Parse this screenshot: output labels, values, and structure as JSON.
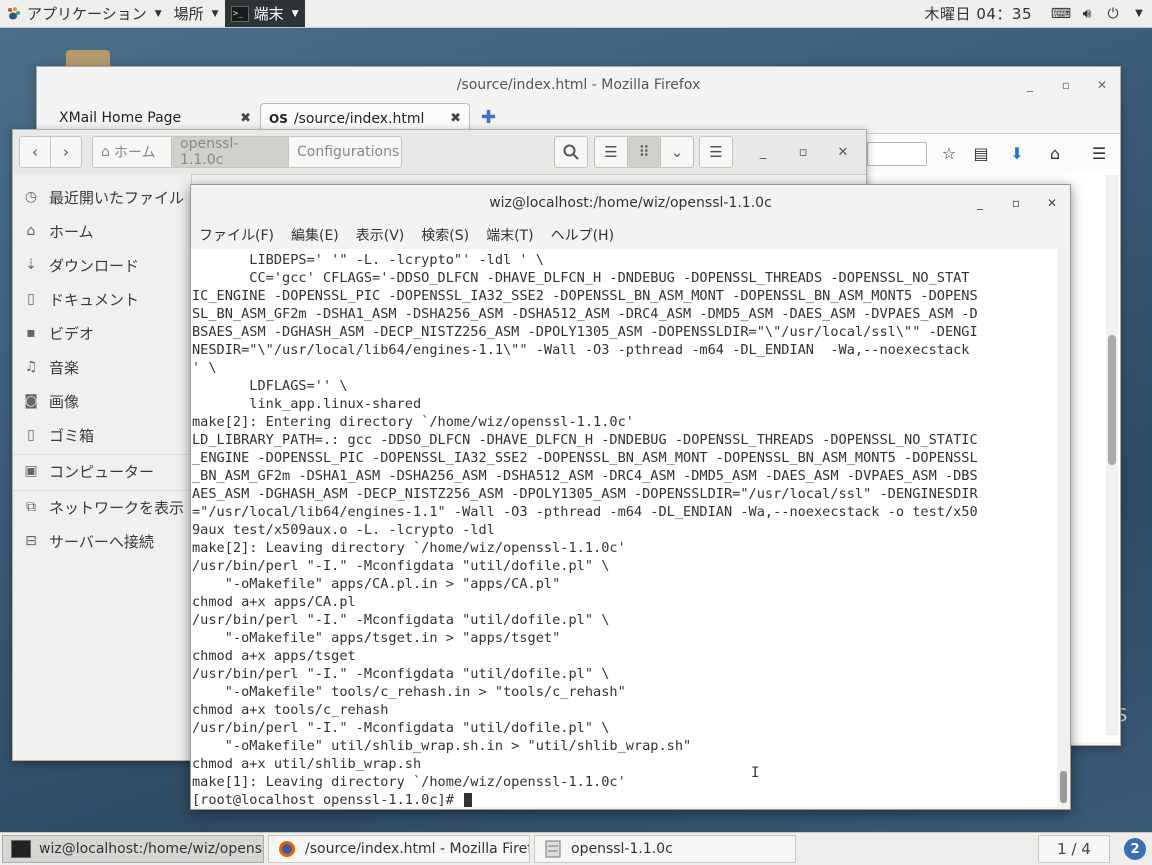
{
  "top_panel": {
    "applications": "アプリケーション",
    "places": "場所",
    "terminal": "端末",
    "clock": "木曜日 04：35"
  },
  "firefox": {
    "title": "/source/index.html - Mozilla Firefox",
    "tabs": [
      {
        "label": "XMail Home Page"
      },
      {
        "label": "/source/index.html"
      }
    ]
  },
  "files": {
    "path": [
      "ホーム",
      "openssl-1.1.0c",
      "Configurations"
    ],
    "sidebar": [
      {
        "label": "最近開いたファイル",
        "icon": "clock-icon"
      },
      {
        "label": "ホーム",
        "icon": "home-icon"
      },
      {
        "label": "ダウンロード",
        "icon": "download-icon"
      },
      {
        "label": "ドキュメント",
        "icon": "document-icon"
      },
      {
        "label": "ビデオ",
        "icon": "video-icon"
      },
      {
        "label": "音楽",
        "icon": "music-icon"
      },
      {
        "label": "画像",
        "icon": "camera-icon"
      },
      {
        "label": "ゴミ箱",
        "icon": "trash-icon"
      },
      {
        "label": "コンピューター",
        "icon": "computer-icon"
      },
      {
        "label": "ネットワークを表示",
        "icon": "network-icon"
      },
      {
        "label": "サーバーへ接続",
        "icon": "server-icon"
      }
    ]
  },
  "terminal": {
    "title": "wiz@localhost:/home/wiz/openssl-1.1.0c",
    "menu": [
      "ファイル(F)",
      "編集(E)",
      "表示(V)",
      "検索(S)",
      "端末(T)",
      "ヘルプ(H)"
    ],
    "lines": [
      "       LIBDEPS=' '\" -L. -lcrypto\"' -ldl ' \\",
      "       CC='gcc' CFLAGS='-DDSO_DLFCN -DHAVE_DLFCN_H -DNDEBUG -DOPENSSL_THREADS -DOPENSSL_NO_STAT",
      "IC_ENGINE -DOPENSSL_PIC -DOPENSSL_IA32_SSE2 -DOPENSSL_BN_ASM_MONT -DOPENSSL_BN_ASM_MONT5 -DOPENS",
      "SL_BN_ASM_GF2m -DSHA1_ASM -DSHA256_ASM -DSHA512_ASM -DRC4_ASM -DMD5_ASM -DAES_ASM -DVPAES_ASM -D",
      "BSAES_ASM -DGHASH_ASM -DECP_NISTZ256_ASM -DPOLY1305_ASM -DOPENSSLDIR=\"\\\"/usr/local/ssl\\\"\" -DENGI",
      "NESDIR=\"\\\"/usr/local/lib64/engines-1.1\\\"\" -Wall -O3 -pthread -m64 -DL_ENDIAN  -Wa,--noexecstack",
      "' \\",
      "       LDFLAGS='' \\",
      "       link_app.linux-shared",
      "make[2]: Entering directory `/home/wiz/openssl-1.1.0c'",
      "LD_LIBRARY_PATH=.: gcc -DDSO_DLFCN -DHAVE_DLFCN_H -DNDEBUG -DOPENSSL_THREADS -DOPENSSL_NO_STATIC",
      "_ENGINE -DOPENSSL_PIC -DOPENSSL_IA32_SSE2 -DOPENSSL_BN_ASM_MONT -DOPENSSL_BN_ASM_MONT5 -DOPENSSL",
      "_BN_ASM_GF2m -DSHA1_ASM -DSHA256_ASM -DSHA512_ASM -DRC4_ASM -DMD5_ASM -DAES_ASM -DVPAES_ASM -DBS",
      "AES_ASM -DGHASH_ASM -DECP_NISTZ256_ASM -DPOLY1305_ASM -DOPENSSLDIR=\"/usr/local/ssl\" -DENGINESDIR",
      "=\"/usr/local/lib64/engines-1.1\" -Wall -O3 -pthread -m64 -DL_ENDIAN -Wa,--noexecstack -o test/x50",
      "9aux test/x509aux.o -L. -lcrypto -ldl",
      "make[2]: Leaving directory `/home/wiz/openssl-1.1.0c'",
      "/usr/bin/perl \"-I.\" -Mconfigdata \"util/dofile.pl\" \\",
      "    \"-oMakefile\" apps/CA.pl.in > \"apps/CA.pl\"",
      "chmod a+x apps/CA.pl",
      "/usr/bin/perl \"-I.\" -Mconfigdata \"util/dofile.pl\" \\",
      "    \"-oMakefile\" apps/tsget.in > \"apps/tsget\"",
      "chmod a+x apps/tsget",
      "/usr/bin/perl \"-I.\" -Mconfigdata \"util/dofile.pl\" \\",
      "    \"-oMakefile\" tools/c_rehash.in > \"tools/c_rehash\"",
      "chmod a+x tools/c_rehash",
      "/usr/bin/perl \"-I.\" -Mconfigdata \"util/dofile.pl\" \\",
      "    \"-oMakefile\" util/shlib_wrap.sh.in > \"util/shlib_wrap.sh\"",
      "chmod a+x util/shlib_wrap.sh",
      "make[1]: Leaving directory `/home/wiz/openssl-1.1.0c'"
    ],
    "prompt": "[root@localhost openssl-1.1.0c]# "
  },
  "taskbar": {
    "tasks": [
      {
        "label": "wiz@localhost:/home/wiz/openss…"
      },
      {
        "label": "/source/index.html - Mozilla Firefox"
      },
      {
        "label": "openssl-1.1.0c"
      }
    ],
    "workspace": "1 / 4",
    "help": "2"
  },
  "desktop": {
    "fragment": "S"
  }
}
